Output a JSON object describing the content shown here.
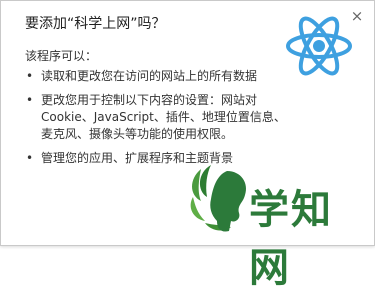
{
  "dialog": {
    "title": "要添加“科学上网”吗？",
    "subtitle": "该程序可以：",
    "close_glyph": "×",
    "permissions": [
      "读取和更改您在访问的网站上的所有数据",
      "更改您用于控制以下内容的设置：网站对Cookie、JavaScript、插件、地理位置信息、麦克风、摄像头等功能的使用权限。",
      "管理您的应用、扩展程序和主题背景"
    ],
    "icon": "atom-icon",
    "accent_color": "#3ea0e0"
  },
  "watermark": {
    "text": "学知网",
    "icon": "leaf-face-logo",
    "color": "#2c7a3a"
  }
}
